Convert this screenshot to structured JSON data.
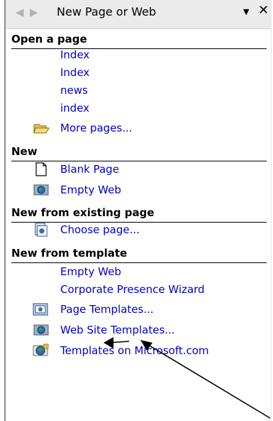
{
  "taskpane": {
    "title": "New Page or Web"
  },
  "open_a_page": {
    "header": "Open a page",
    "items": [
      "Index",
      "Index",
      "news",
      "index"
    ],
    "more_pages": "More pages..."
  },
  "new": {
    "header": "New",
    "blank_page": "Blank Page",
    "empty_web": "Empty Web"
  },
  "new_from_existing": {
    "header": "New from existing page",
    "choose_page": "Choose page..."
  },
  "new_from_template": {
    "header": "New from template",
    "empty_web": "Empty Web",
    "corporate_wizard": "Corporate Presence Wizard",
    "page_templates": "Page Templates...",
    "web_site_templates": "Web Site Templates...",
    "templates_on_microsoft": "Templates on Microsoft.com"
  }
}
